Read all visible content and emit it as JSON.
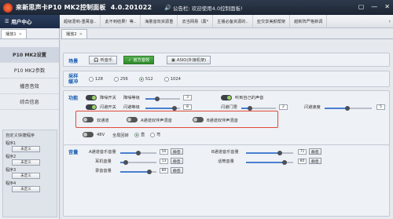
{
  "titlebar": {
    "app_title": "來新思声卡P10 MK2控制面板",
    "version": "4.0.201022",
    "notice_label": "公告栏:",
    "notice_text": "欢迎使用4.0控制面板!",
    "window_controls": [
      "▢",
      "—",
      "✕"
    ]
  },
  "navbar": {
    "user_center": "用户中心",
    "items": [
      "超级混响-重萬音..",
      "此不到结果！等..",
      "海量音效资源重",
      "去当网易（黑*",
      "主播必备资源的..",
      "亚交享美颜帮架",
      "越新阵严格新调"
    ]
  },
  "sidebar": {
    "tab1": "播放1",
    "tab2": "播放2",
    "menu": [
      "P10 MK2设置",
      "P10 MK2参数",
      "播音音效",
      "综合信息"
    ],
    "custom": {
      "title": "自定义快捷程序",
      "programs": [
        {
          "label": "程序1",
          "button": "未定义"
        },
        {
          "label": "程序2",
          "button": "未定义"
        },
        {
          "label": "程序3",
          "button": "未定义"
        },
        {
          "label": "程序4",
          "button": "未定义"
        }
      ]
    }
  },
  "scene": {
    "label": "场景",
    "buttons": [
      "听音乐",
      "官方音效",
      "ASIO(外接机架)"
    ],
    "selected": "官方音效"
  },
  "sample": {
    "label": "采样 缓冲",
    "options": [
      "128",
      "256",
      "512",
      "1024"
    ],
    "selected": "512"
  },
  "functions": {
    "label": "功能",
    "row1": {
      "a": "降噪开关",
      "b": "降噪等级",
      "b_value": "3",
      "c": "听到自己的声音"
    },
    "row2": {
      "a": "闪避开关",
      "b": "闪避等级",
      "b_value": "8",
      "c": "闪避门限",
      "c_value": "2",
      "d": "闪避速度",
      "d_value": "5"
    },
    "row3": [
      "双通道",
      "A通道双伴声混音",
      "B通道双伴声混音"
    ],
    "row4": {
      "a": "48V",
      "b": "全局回转",
      "r1": "直",
      "r2": "弯"
    }
  },
  "volume": {
    "label": "音量",
    "a_master": {
      "label": "A通道音乐音量",
      "value": "50",
      "mute": "静音"
    },
    "earphone": {
      "label": "耳机音量",
      "value": "13",
      "mute": "静音"
    },
    "record": {
      "label": "录音音量",
      "value": "80",
      "mute": "静音"
    },
    "b_master": {
      "label": "B通道音乐音量",
      "value": "71",
      "mute": "静音"
    },
    "b_mic": {
      "label": "话筒音量",
      "value": "80",
      "mute": "静音"
    }
  },
  "colors": {
    "accent_red": "#e24a3a",
    "active_green": "#2e8a2a",
    "title_dark": "#1c2533"
  }
}
